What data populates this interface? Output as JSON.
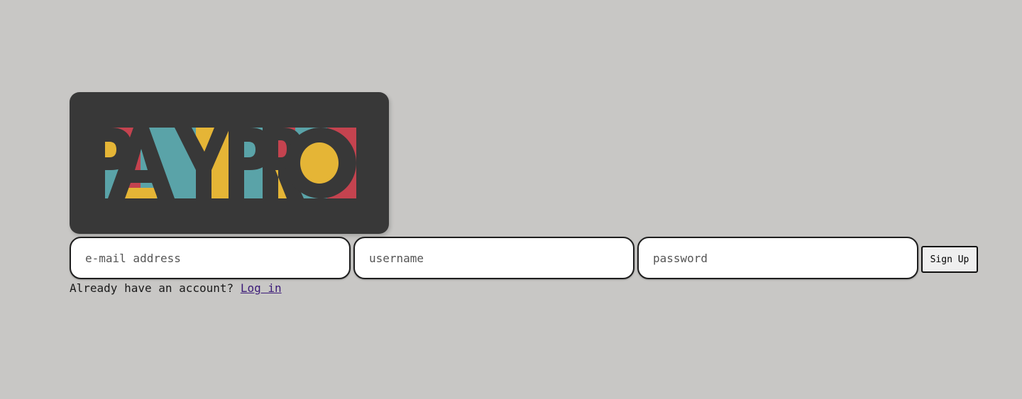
{
  "logo": {
    "text": "PAYPRO",
    "colors": {
      "card": "#383838",
      "teal": "#5aa3a8",
      "red": "#c4434f",
      "yellow": "#e5b536",
      "dark": "#383838"
    }
  },
  "form": {
    "email_placeholder": "e-mail address",
    "username_placeholder": "username",
    "password_placeholder": "password",
    "submit_label": "Sign Up"
  },
  "footer": {
    "prompt": "Already have an account?",
    "login_link": "Log in"
  }
}
